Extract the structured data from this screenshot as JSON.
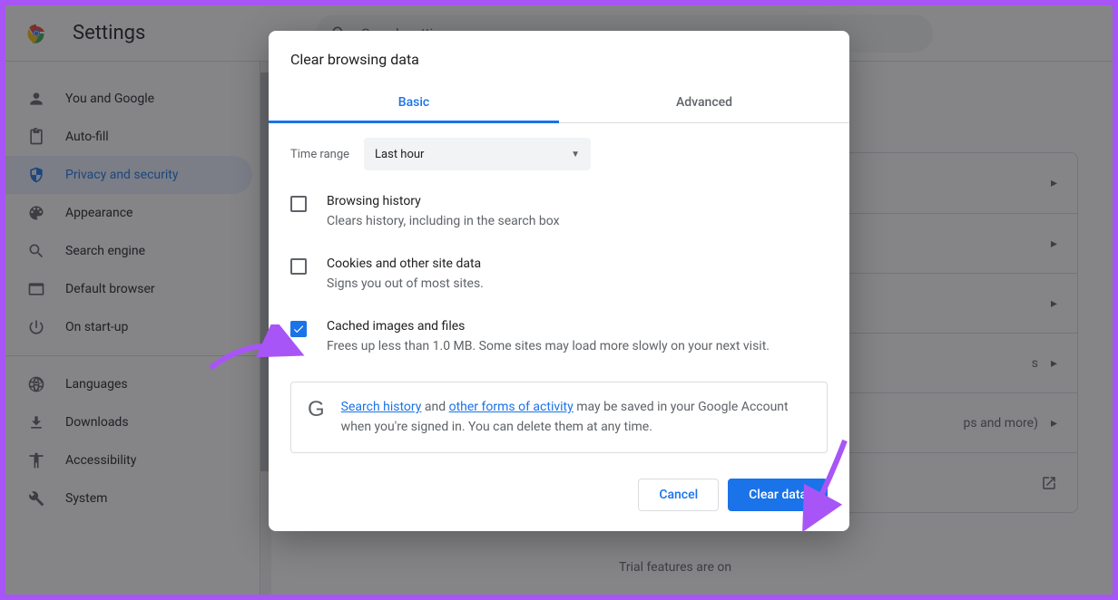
{
  "header": {
    "title": "Settings",
    "search_placeholder": "Search settings"
  },
  "sidebar": {
    "items": [
      {
        "label": "You and Google"
      },
      {
        "label": "Auto-fill"
      },
      {
        "label": "Privacy and security"
      },
      {
        "label": "Appearance"
      },
      {
        "label": "Search engine"
      },
      {
        "label": "Default browser"
      },
      {
        "label": "On start-up"
      }
    ],
    "more_items": [
      {
        "label": "Languages"
      },
      {
        "label": "Downloads"
      },
      {
        "label": "Accessibility"
      },
      {
        "label": "System"
      }
    ]
  },
  "main": {
    "card_rows": [
      {
        "text_right": "s"
      },
      {
        "text_right": "ps and more)"
      }
    ],
    "trial_text": "Trial features are on"
  },
  "dialog": {
    "title": "Clear browsing data",
    "tabs": {
      "basic": "Basic",
      "advanced": "Advanced"
    },
    "time_range": {
      "label": "Time range",
      "value": "Last hour"
    },
    "options": [
      {
        "title": "Browsing history",
        "desc": "Clears history, including in the search box",
        "checked": false
      },
      {
        "title": "Cookies and other site data",
        "desc": "Signs you out of most sites.",
        "checked": false
      },
      {
        "title": "Cached images and files",
        "desc": "Frees up less than 1.0 MB. Some sites may load more slowly on your next visit.",
        "checked": true
      }
    ],
    "info": {
      "link1": "Search history",
      "mid1": " and ",
      "link2": "other forms of activity",
      "rest": " may be saved in your Google Account when you're signed in. You can delete them at any time."
    },
    "buttons": {
      "cancel": "Cancel",
      "confirm": "Clear data"
    }
  }
}
